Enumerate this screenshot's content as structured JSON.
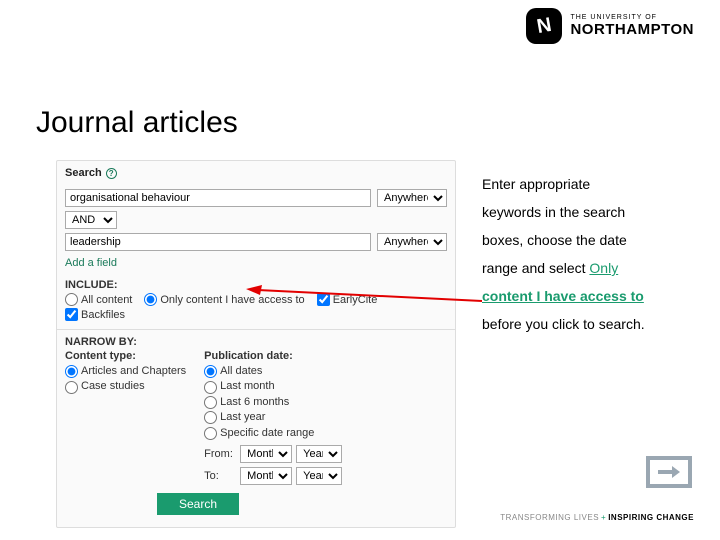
{
  "brand": {
    "subtitle": "THE UNIVERSITY OF",
    "name": "NORTHAMPTON"
  },
  "title": "Journal articles",
  "panel": {
    "search_label": "Search",
    "kw1_value": "organisational behaviour",
    "anywhere": "Anywhere",
    "and": "AND",
    "kw2_value": "leadership",
    "add_field": "Add a field",
    "include_label": "INCLUDE:",
    "include": {
      "all": "All content",
      "only": "Only content I have access to",
      "earlycite": "EarlyCite",
      "backfiles": "Backfiles"
    },
    "narrow_label": "NARROW BY:",
    "content_type_label": "Content type:",
    "content_type": {
      "articles": "Articles and Chapters",
      "cases": "Case studies"
    },
    "pubdate_label": "Publication date:",
    "pubdate_opts": {
      "all": "All dates",
      "lastm": "Last month",
      "last6": "Last 6 months",
      "lasty": "Last year",
      "range": "Specific date range"
    },
    "from": "From:",
    "to": "To:",
    "month": "Month",
    "year": "Year",
    "search_btn": "Search"
  },
  "instruct": {
    "l1": "Enter appropriate",
    "l2": "keywords in the search",
    "l3": "boxes, choose the date",
    "l4a": "range and select ",
    "l4b": "Only",
    "l5": "content I have access to",
    "l6": "before you click to search."
  },
  "tagline": {
    "left": "TRANSFORMING LIVES",
    "plus": "+",
    "right": "INSPIRING CHANGE"
  }
}
